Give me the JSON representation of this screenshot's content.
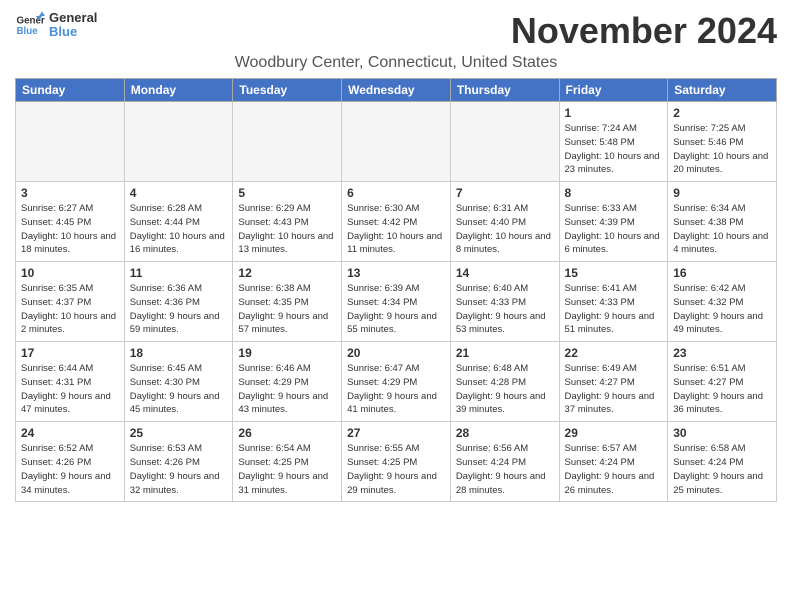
{
  "header": {
    "logo_line1": "General",
    "logo_line2": "Blue",
    "month_title": "November 2024",
    "location": "Woodbury Center, Connecticut, United States"
  },
  "day_headers": [
    "Sunday",
    "Monday",
    "Tuesday",
    "Wednesday",
    "Thursday",
    "Friday",
    "Saturday"
  ],
  "weeks": [
    [
      {
        "day": "",
        "info": ""
      },
      {
        "day": "",
        "info": ""
      },
      {
        "day": "",
        "info": ""
      },
      {
        "day": "",
        "info": ""
      },
      {
        "day": "",
        "info": ""
      },
      {
        "day": "1",
        "info": "Sunrise: 7:24 AM\nSunset: 5:48 PM\nDaylight: 10 hours and 23 minutes."
      },
      {
        "day": "2",
        "info": "Sunrise: 7:25 AM\nSunset: 5:46 PM\nDaylight: 10 hours and 20 minutes."
      }
    ],
    [
      {
        "day": "3",
        "info": "Sunrise: 6:27 AM\nSunset: 4:45 PM\nDaylight: 10 hours and 18 minutes."
      },
      {
        "day": "4",
        "info": "Sunrise: 6:28 AM\nSunset: 4:44 PM\nDaylight: 10 hours and 16 minutes."
      },
      {
        "day": "5",
        "info": "Sunrise: 6:29 AM\nSunset: 4:43 PM\nDaylight: 10 hours and 13 minutes."
      },
      {
        "day": "6",
        "info": "Sunrise: 6:30 AM\nSunset: 4:42 PM\nDaylight: 10 hours and 11 minutes."
      },
      {
        "day": "7",
        "info": "Sunrise: 6:31 AM\nSunset: 4:40 PM\nDaylight: 10 hours and 8 minutes."
      },
      {
        "day": "8",
        "info": "Sunrise: 6:33 AM\nSunset: 4:39 PM\nDaylight: 10 hours and 6 minutes."
      },
      {
        "day": "9",
        "info": "Sunrise: 6:34 AM\nSunset: 4:38 PM\nDaylight: 10 hours and 4 minutes."
      }
    ],
    [
      {
        "day": "10",
        "info": "Sunrise: 6:35 AM\nSunset: 4:37 PM\nDaylight: 10 hours and 2 minutes."
      },
      {
        "day": "11",
        "info": "Sunrise: 6:36 AM\nSunset: 4:36 PM\nDaylight: 9 hours and 59 minutes."
      },
      {
        "day": "12",
        "info": "Sunrise: 6:38 AM\nSunset: 4:35 PM\nDaylight: 9 hours and 57 minutes."
      },
      {
        "day": "13",
        "info": "Sunrise: 6:39 AM\nSunset: 4:34 PM\nDaylight: 9 hours and 55 minutes."
      },
      {
        "day": "14",
        "info": "Sunrise: 6:40 AM\nSunset: 4:33 PM\nDaylight: 9 hours and 53 minutes."
      },
      {
        "day": "15",
        "info": "Sunrise: 6:41 AM\nSunset: 4:33 PM\nDaylight: 9 hours and 51 minutes."
      },
      {
        "day": "16",
        "info": "Sunrise: 6:42 AM\nSunset: 4:32 PM\nDaylight: 9 hours and 49 minutes."
      }
    ],
    [
      {
        "day": "17",
        "info": "Sunrise: 6:44 AM\nSunset: 4:31 PM\nDaylight: 9 hours and 47 minutes."
      },
      {
        "day": "18",
        "info": "Sunrise: 6:45 AM\nSunset: 4:30 PM\nDaylight: 9 hours and 45 minutes."
      },
      {
        "day": "19",
        "info": "Sunrise: 6:46 AM\nSunset: 4:29 PM\nDaylight: 9 hours and 43 minutes."
      },
      {
        "day": "20",
        "info": "Sunrise: 6:47 AM\nSunset: 4:29 PM\nDaylight: 9 hours and 41 minutes."
      },
      {
        "day": "21",
        "info": "Sunrise: 6:48 AM\nSunset: 4:28 PM\nDaylight: 9 hours and 39 minutes."
      },
      {
        "day": "22",
        "info": "Sunrise: 6:49 AM\nSunset: 4:27 PM\nDaylight: 9 hours and 37 minutes."
      },
      {
        "day": "23",
        "info": "Sunrise: 6:51 AM\nSunset: 4:27 PM\nDaylight: 9 hours and 36 minutes."
      }
    ],
    [
      {
        "day": "24",
        "info": "Sunrise: 6:52 AM\nSunset: 4:26 PM\nDaylight: 9 hours and 34 minutes."
      },
      {
        "day": "25",
        "info": "Sunrise: 6:53 AM\nSunset: 4:26 PM\nDaylight: 9 hours and 32 minutes."
      },
      {
        "day": "26",
        "info": "Sunrise: 6:54 AM\nSunset: 4:25 PM\nDaylight: 9 hours and 31 minutes."
      },
      {
        "day": "27",
        "info": "Sunrise: 6:55 AM\nSunset: 4:25 PM\nDaylight: 9 hours and 29 minutes."
      },
      {
        "day": "28",
        "info": "Sunrise: 6:56 AM\nSunset: 4:24 PM\nDaylight: 9 hours and 28 minutes."
      },
      {
        "day": "29",
        "info": "Sunrise: 6:57 AM\nSunset: 4:24 PM\nDaylight: 9 hours and 26 minutes."
      },
      {
        "day": "30",
        "info": "Sunrise: 6:58 AM\nSunset: 4:24 PM\nDaylight: 9 hours and 25 minutes."
      }
    ]
  ]
}
